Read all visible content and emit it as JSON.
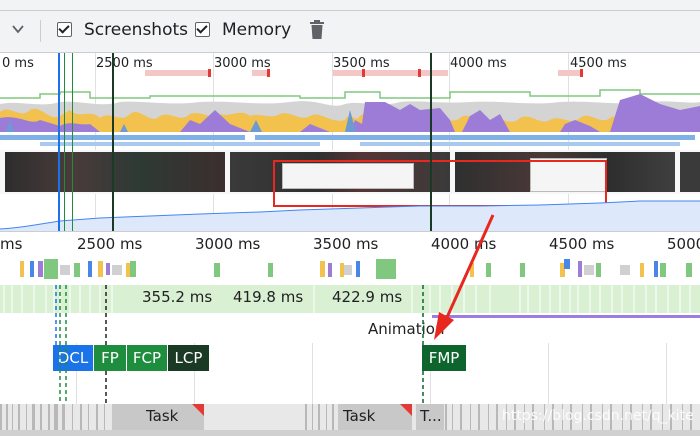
{
  "toolbar": {
    "screenshots_label": "Screenshots",
    "memory_label": "Memory"
  },
  "overview": {
    "ticks": [
      "0 ms",
      "2500 ms",
      "3000 ms",
      "3500 ms",
      "4000 ms",
      "4500 ms"
    ]
  },
  "timeline": {
    "ticks": [
      "ms",
      "2500 ms",
      "3000 ms",
      "3500 ms",
      "4000 ms",
      "4500 ms",
      "5000"
    ]
  },
  "frames": [
    "355.2 ms",
    "419.8 ms",
    "422.9 ms"
  ],
  "animation_label": "Animation",
  "markers": {
    "dcl": "DCL",
    "fp": "FP",
    "fcp": "FCP",
    "lcp": "LCP",
    "fmp": "FMP"
  },
  "tasks": [
    "Task",
    "Task",
    "T..."
  ],
  "watermark": "https://blog.csdn.net/q_kite",
  "colors": {
    "dcl": "#1a73e8",
    "fp": "#1e8e3e",
    "fcp": "#1e8e3e",
    "lcp": "#1e3a2a",
    "fmp": "#0d652d",
    "annotation": "#e8271f"
  }
}
